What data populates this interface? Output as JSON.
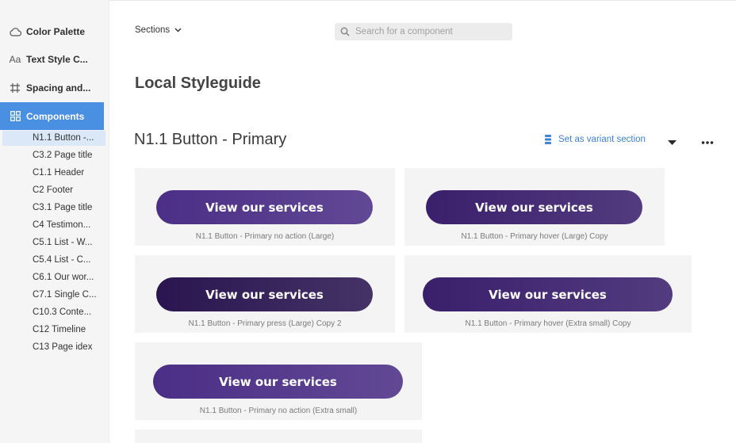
{
  "sidebar": {
    "nav": [
      {
        "label": "Color Palette",
        "icon": "cloud-icon"
      },
      {
        "label": "Text Style C...",
        "icon": "text-style-icon"
      },
      {
        "label": "Spacing and...",
        "icon": "spacing-grid-icon"
      },
      {
        "label": "Components",
        "icon": "components-grid-icon",
        "active": true
      }
    ],
    "components": [
      "N1.1 Button -...",
      "C3.2 Page title",
      "C1.1 Header",
      "C2 Footer",
      "C3.1 Page title",
      "C4 Testimon...",
      "C5.1 List - W...",
      "C5.4 List - C...",
      "C6.1 Our wor...",
      "C7.1 Single C...",
      "C10.3 Conte...",
      "C12 Timeline",
      "C13 Page idex"
    ]
  },
  "header": {
    "sections_label": "Sections",
    "search_placeholder": "Search for a component"
  },
  "page_title": "Local Styleguide",
  "section": {
    "title": "N1.1 Button - Primary",
    "variant_link": "Set as variant section"
  },
  "cards": [
    {
      "button_label": "View our services",
      "caption": "N1.1 Button - Primary no action (Large)",
      "button_color": "#4b2e86"
    },
    {
      "button_label": "View our services",
      "caption": "N1.1 Button - Primary hover (Large) Copy",
      "button_color": "#3a1f6c"
    },
    {
      "button_label": "View our services",
      "caption": "N1.1 Button - Primary press (Large) Copy 2",
      "button_color": "#2a1550"
    },
    {
      "button_label": "View our services",
      "caption": "N1.1 Button - Primary hover (Extra small) Copy",
      "button_color": "#3a1f6c"
    },
    {
      "button_label": "View our services",
      "caption": "N1.1 Button - Primary no action (Extra small)",
      "button_color": "#4b2e86"
    }
  ],
  "colors": {
    "accent_blue": "#4a90e2",
    "link_blue": "#3f82d6",
    "card_bg": "#f4f4f4"
  }
}
